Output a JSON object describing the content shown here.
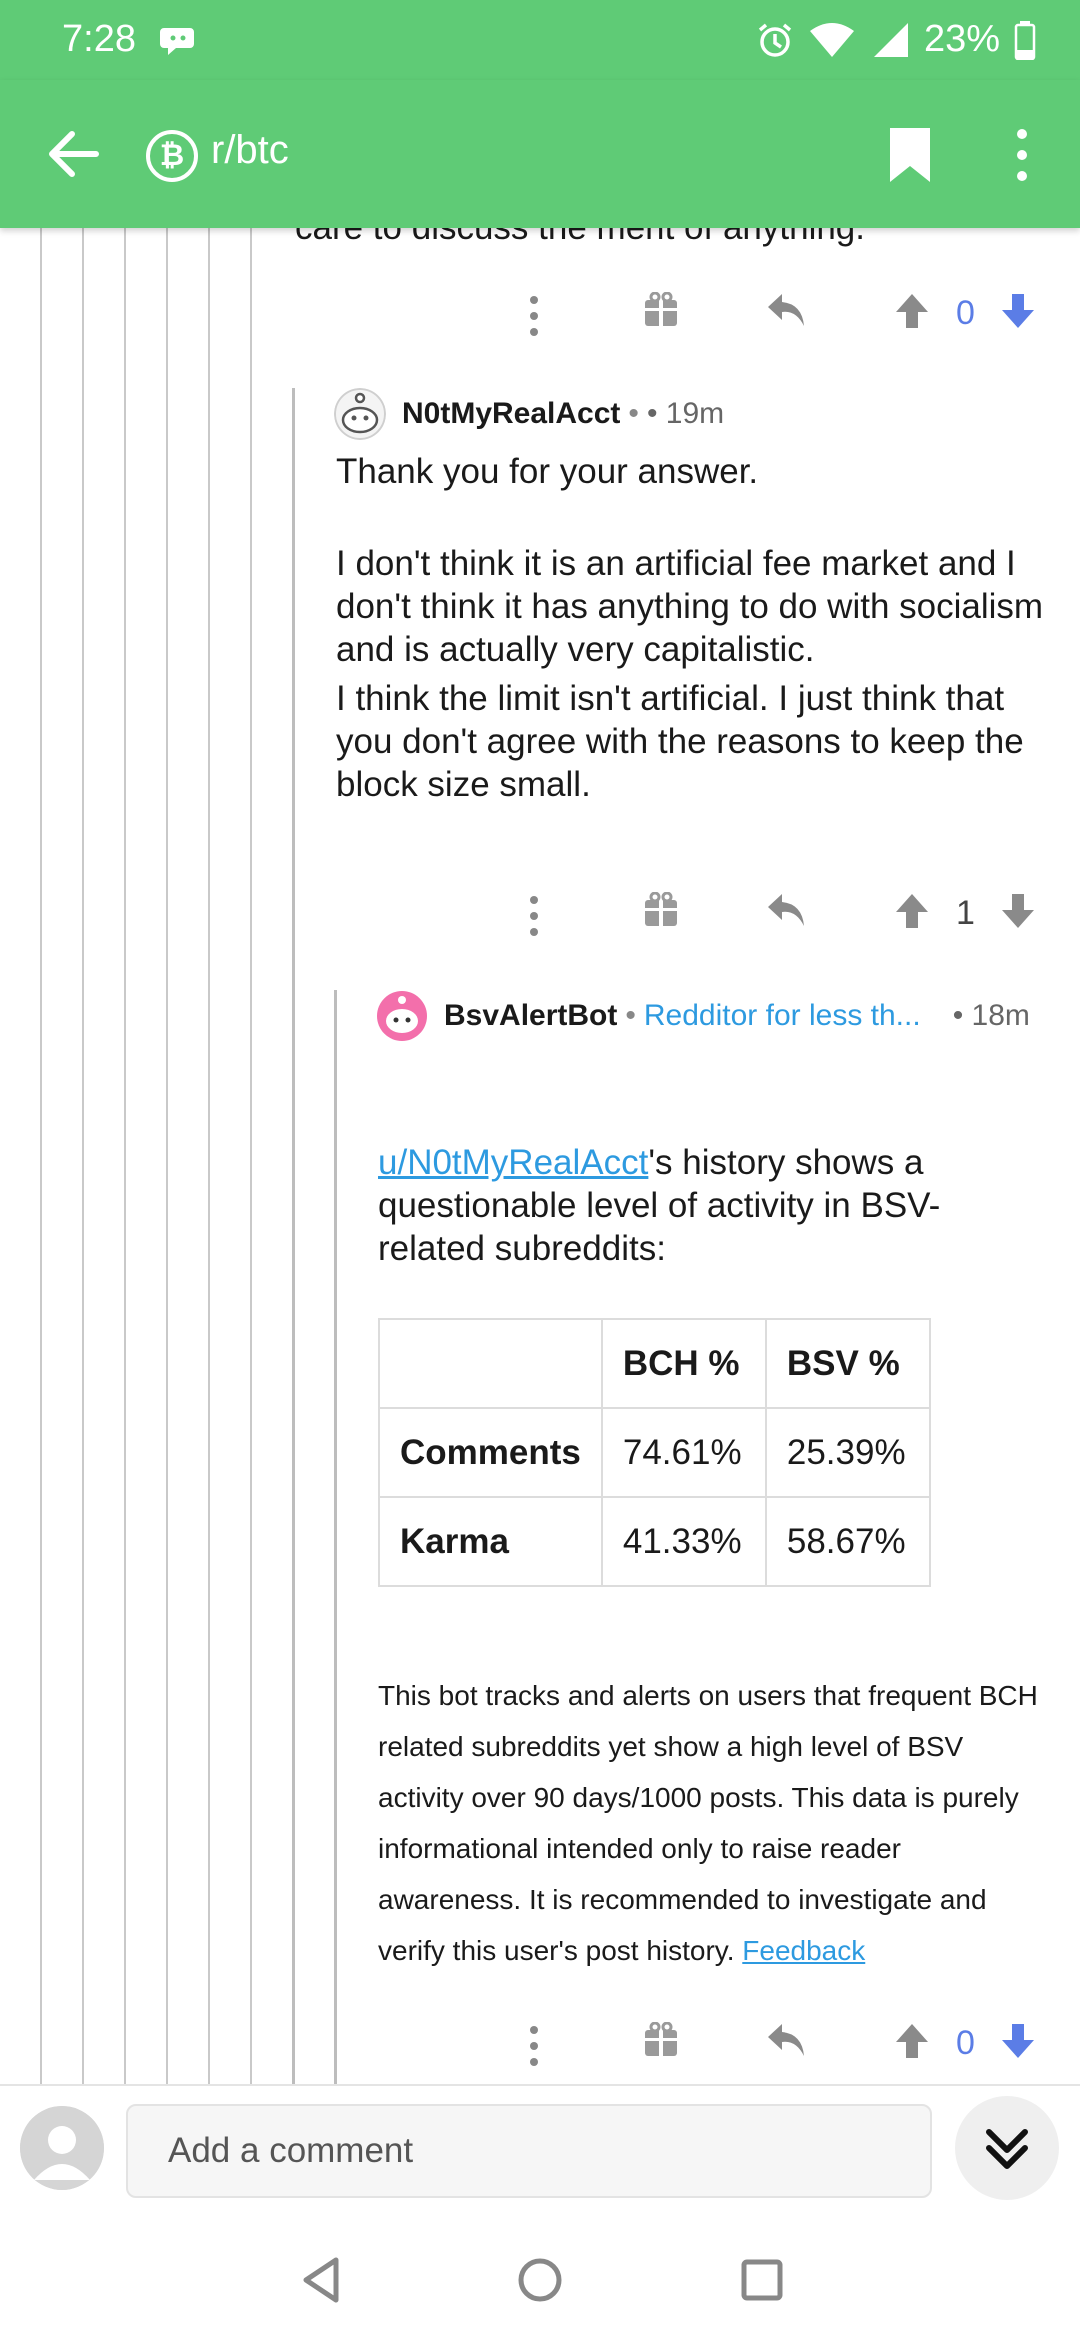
{
  "status_bar": {
    "time": "7:28",
    "battery": "23%"
  },
  "app_bar": {
    "subreddit": "r/btc",
    "sub_icon_glyph": "₿"
  },
  "thread": {
    "cut_text": "care to discuss the merit of anything.",
    "comments": [
      {
        "author": "N0tMyRealAcct",
        "flair_sep": "• ",
        "age": "• 19m",
        "paragraphs": [
          "Thank you for your answer.",
          "I don't think it is an artificial fee market and I don't think it has anything to do with socialism and is actually very capitalistic.",
          "I think the limit isn't artificial. I just think that you don't agree with the reasons to keep the block size small."
        ],
        "score": "1"
      },
      {
        "author": "BsvAlertBot",
        "flair_sep": "• ",
        "flair": "Redditor for less th...",
        "age": "• 18m",
        "mention": "u/N0tMyRealAcct",
        "intro": "'s history shows a questionable level of activity in BSV-related subreddits:",
        "table": {
          "headers": [
            "",
            "BCH %",
            "BSV %"
          ],
          "rows": [
            [
              "Comments",
              "74.61%",
              "25.39%"
            ],
            [
              "Karma",
              "41.33%",
              "58.67%"
            ]
          ]
        },
        "note": "This bot tracks and alerts on users that frequent BCH related subreddits yet show a high level of BSV activity over 90 days/1000 posts. This data is purely informational intended only to raise reader awareness. It is recommended to investigate and verify this user's post history.",
        "feedback": "Feedback",
        "score": "0"
      }
    ],
    "parent_score": "0"
  },
  "composer": {
    "placeholder": "Add a comment"
  },
  "colors": {
    "brand": "#5fcb76",
    "upvote_active": "#5b7de6",
    "link": "#2d9ae0"
  },
  "icons": [
    "back-arrow-icon",
    "bitcoin-icon",
    "bookmark-icon",
    "more-vertical-icon",
    "more-vertical-icon",
    "award-icon",
    "reply-icon",
    "upvote-icon",
    "downvote-icon",
    "chevron-double-down-icon",
    "nav-back-icon",
    "nav-home-icon",
    "nav-recents-icon"
  ]
}
